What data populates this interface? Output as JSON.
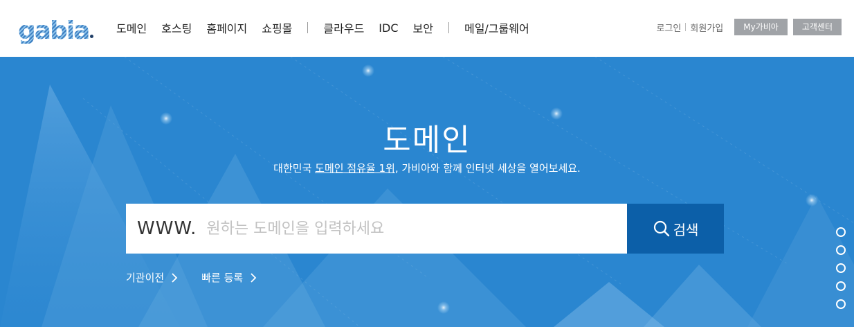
{
  "header": {
    "logo": "gabia",
    "nav": [
      "도메인",
      "호스팅",
      "홈페이지",
      "쇼핑몰",
      "클라우드",
      "IDC",
      "보안",
      "메일/그룹웨어"
    ],
    "util": {
      "login": "로그인",
      "signup": "회원가입",
      "my_gabia": "My가비아",
      "support": "고객센터"
    }
  },
  "hero": {
    "title": "도메인",
    "subtitle_prefix": "대한민국 ",
    "subtitle_link": "도메인 점유율 1위",
    "subtitle_suffix": ", 가비아와 함께 인터넷 세상을 열어보세요.",
    "search": {
      "prefix": "WWW.",
      "placeholder": "원하는 도메인을 입력하세요",
      "value": "",
      "button_label": "검색"
    },
    "quick_links": [
      "기관이전",
      "빠른 등록"
    ],
    "slide_count": 5
  },
  "colors": {
    "hero_bg": "#2a86d0",
    "search_button": "#0c5fa8",
    "util_button": "#a0a3a7",
    "logo": "#2d6fb6"
  }
}
